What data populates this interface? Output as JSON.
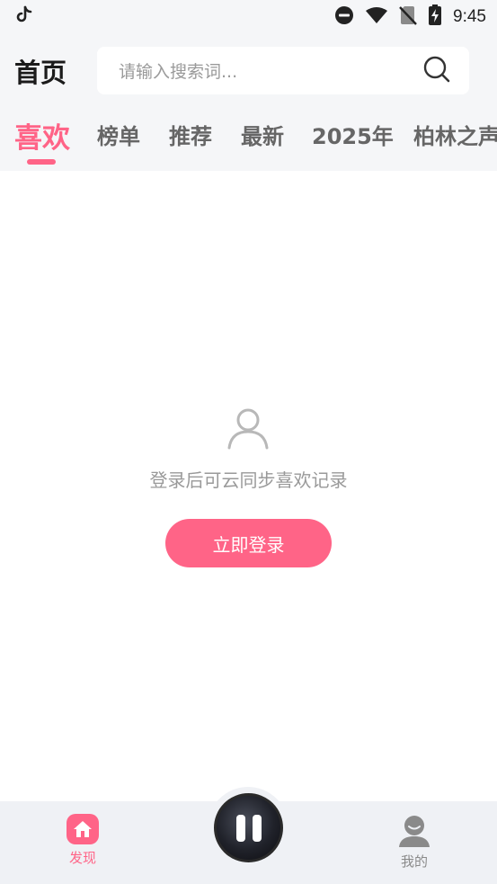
{
  "status_bar": {
    "time": "9:45",
    "icons": [
      "tiktok-icon",
      "do-not-disturb-icon",
      "wifi-icon",
      "no-sim-icon",
      "battery-charging-icon"
    ]
  },
  "header": {
    "title": "首页",
    "search": {
      "placeholder": "请输入搜索词..."
    }
  },
  "tabs": [
    {
      "label": "喜欢",
      "active": true
    },
    {
      "label": "榜单",
      "active": false
    },
    {
      "label": "推荐",
      "active": false
    },
    {
      "label": "最新",
      "active": false
    },
    {
      "label": "2025年",
      "active": false
    },
    {
      "label": "柏林之声",
      "active": false
    }
  ],
  "empty_state": {
    "icon": "user-outline-icon",
    "message": "登录后可云同步喜欢记录",
    "button_label": "立即登录"
  },
  "bottom_nav": {
    "discover_label": "发现",
    "mine_label": "我的",
    "player_state": "playing"
  },
  "colors": {
    "accent": "#ff6487",
    "background": "#f5f6f8",
    "nav_background": "#eff1f5"
  }
}
